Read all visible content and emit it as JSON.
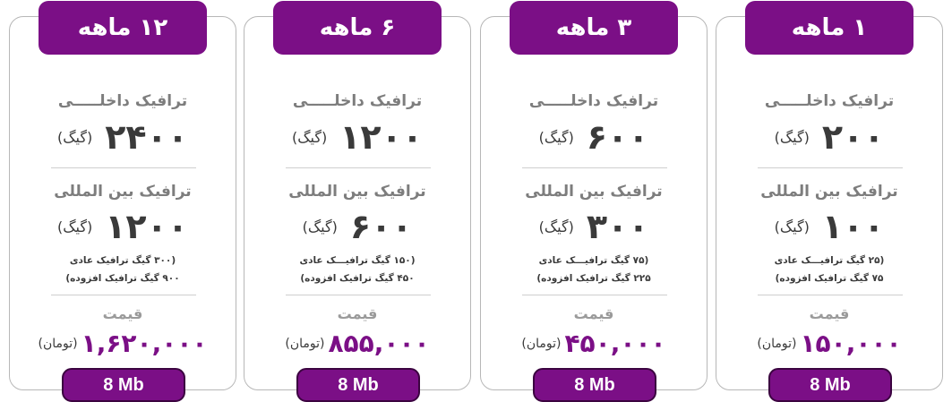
{
  "accent_color": "#7b0f86",
  "plans": [
    {
      "header": "۱۲ ماهه",
      "domestic_label": "ترافیک داخلـــــی",
      "domestic_value": "۲۴۰۰",
      "intl_label": "ترافیک بین المللی",
      "intl_value": "۱۲۰۰",
      "unit": "(گیگ)",
      "note1": "(۳۰۰ گیگ ترافیک عادی",
      "note2": "۹۰۰ گیگ ترافیک افزوده)",
      "price_label": "قیمت",
      "price": "۱,۶۲۰,۰۰۰",
      "currency": "(تومان)",
      "speed": "8 Mb"
    },
    {
      "header": "۶ ماهه",
      "domestic_label": "ترافیک داخلـــــی",
      "domestic_value": "۱۲۰۰",
      "intl_label": "ترافیک بین المللی",
      "intl_value": "۶۰۰",
      "unit": "(گیگ)",
      "note1": "(۱۵۰ گیگ ترافیـــک عادی",
      "note2": "۴۵۰ گیگ ترافیک افزوده)",
      "price_label": "قیمت",
      "price": "۸۵۵,۰۰۰",
      "currency": "(تومان)",
      "speed": "8 Mb"
    },
    {
      "header": "۳ ماهه",
      "domestic_label": "ترافیک داخلـــــی",
      "domestic_value": "۶۰۰",
      "intl_label": "ترافیک بین المللی",
      "intl_value": "۳۰۰",
      "unit": "(گیگ)",
      "note1": "(۷۵ گیگ ترافیـــک عادی",
      "note2": "۲۲۵ گیگ ترافیک افزوده)",
      "price_label": "قیمت",
      "price": "۴۵۰,۰۰۰",
      "currency": "(تومان)",
      "speed": "8 Mb"
    },
    {
      "header": "۱ ماهه",
      "domestic_label": "ترافیک داخلـــــی",
      "domestic_value": "۲۰۰",
      "intl_label": "ترافیک بین المللی",
      "intl_value": "۱۰۰",
      "unit": "(گیگ)",
      "note1": "(۲۵ گیگ ترافیـــک عادی",
      "note2": "۷۵ گیگ ترافیک افزوده)",
      "price_label": "قیمت",
      "price": "۱۵۰,۰۰۰",
      "currency": "(تومان)",
      "speed": "8 Mb"
    }
  ]
}
